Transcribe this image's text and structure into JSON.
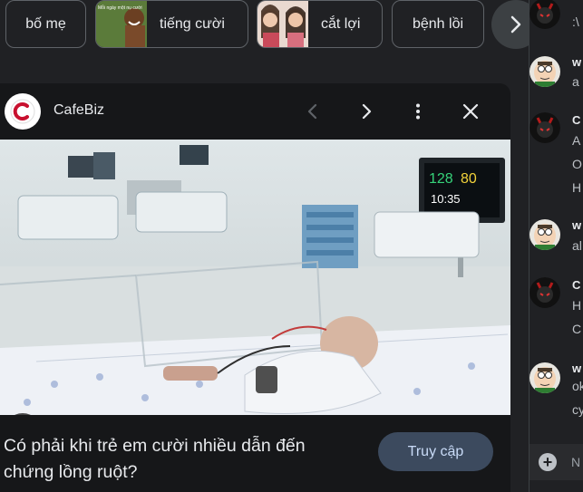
{
  "chips": [
    {
      "label": "bố mẹ"
    },
    {
      "label": "tiếng cười",
      "thumb_text": "Mỗi ngày một nụ cười"
    },
    {
      "label": "cắt lợi"
    },
    {
      "label": "bệnh lồi"
    }
  ],
  "card": {
    "source": "CafeBiz",
    "caption": "Có phải khi trẻ em cười nhiều dẫn đến chứng lồng ruột?",
    "visit_label": "Truy cập",
    "monitor": {
      "hr": "128",
      "spo2": "80",
      "time": "10:35"
    }
  },
  "chat": {
    "messages": [
      {
        "avatar": "devil",
        "lines": [
          ":\\"
        ]
      },
      {
        "avatar": "peter",
        "name": "w",
        "lines": [
          "a"
        ]
      },
      {
        "avatar": "devil",
        "name": "C",
        "lines": [
          "A",
          "O",
          "H"
        ]
      },
      {
        "avatar": "peter",
        "name": "w",
        "lines": [
          "al"
        ]
      },
      {
        "avatar": "devil",
        "name": "C",
        "lines": [
          "H",
          "C"
        ]
      },
      {
        "avatar": "peter",
        "name": "w",
        "lines": [
          "ok",
          "cy"
        ]
      }
    ],
    "input_placeholder": "N"
  },
  "colors": {
    "background": "#202124",
    "card": "#161719",
    "visit_button": "#3c4a5e",
    "visit_text": "#c9dbf7"
  }
}
